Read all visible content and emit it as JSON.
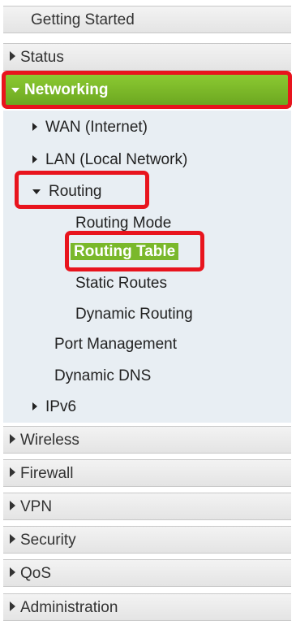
{
  "nav": {
    "getting_started": "Getting Started",
    "status": "Status",
    "networking": "Networking",
    "networking_children": {
      "wan": "WAN (Internet)",
      "lan": "LAN (Local Network)",
      "routing": "Routing",
      "routing_children": {
        "routing_mode": "Routing Mode",
        "routing_table": "Routing Table",
        "static_routes": "Static Routes",
        "dynamic_routing": "Dynamic Routing"
      },
      "port_management": "Port Management",
      "dynamic_dns": "Dynamic DNS",
      "ipv6": "IPv6"
    },
    "wireless": "Wireless",
    "firewall": "Firewall",
    "vpn": "VPN",
    "security": "Security",
    "qos": "QoS",
    "administration": "Administration"
  },
  "colors": {
    "active_green": "#7ab82b",
    "highlight_red": "#e8141d",
    "submenu_bg": "#e8eef3"
  }
}
